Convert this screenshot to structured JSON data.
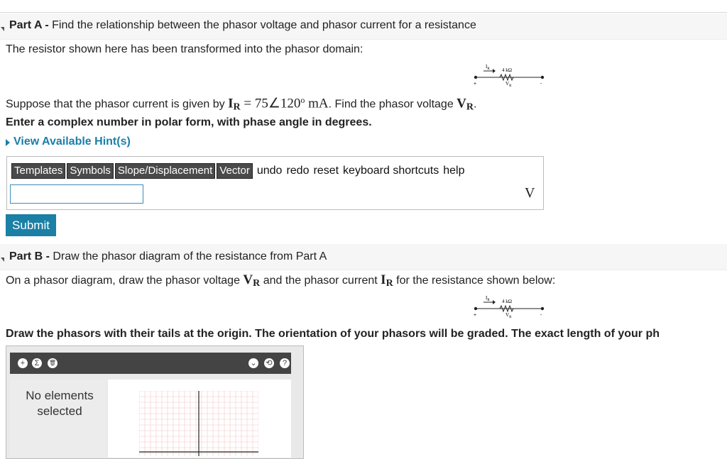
{
  "partA": {
    "label": "Part A - ",
    "title": "Find the relationship between the phasor voltage and phasor current for a resistance",
    "intro": "The resistor shown here has been transformed into the phasor domain:",
    "question_prefix": "Suppose that the phasor current is given by ",
    "I_sym": "I",
    "I_sub": "R",
    "eq": " = 75∠120",
    "deg": "o",
    "unit_ma": " mA",
    "question_mid": ". Find the phasor voltage ",
    "V_sym": "V",
    "V_sub": "R",
    "question_end": ".",
    "instruction": "Enter a complex number in polar form, with phase angle in degrees.",
    "hint": "View Available Hint(s)",
    "toolbar": {
      "templates": "Templates",
      "symbols": "Symbols",
      "slope": "Slope/Displacement",
      "vector": "Vector",
      "undo": "undo",
      "redo": "redo",
      "reset": "reset",
      "keyboard": "keyboard shortcuts",
      "help": "help"
    },
    "answer_value": "",
    "answer_unit": "V",
    "submit": "Submit"
  },
  "circuit": {
    "current_label": "I",
    "current_sub": "R",
    "resistance": "4 kΩ",
    "voltage_label": "V",
    "voltage_sub": "R",
    "plus": "+",
    "minus": "-"
  },
  "partB": {
    "label": "Part B - ",
    "title": "Draw the phasor diagram of the resistance from Part A",
    "intro_prefix": "On a phasor diagram, draw the phasor voltage ",
    "V_sym": "V",
    "V_sub": "R",
    "intro_mid": " and the phasor current ",
    "I_sym": "I",
    "I_sub": "R",
    "intro_end": " for the resistance shown below:",
    "instruction": "Draw the phasors with their tails at the origin. The orientation of your phasors will be graded. The exact length of your ph",
    "tool": {
      "add": "+",
      "sigma": "Σ",
      "trash": "🗑",
      "chevron": "⌄",
      "reset": "⟲",
      "help": "?",
      "no_elements": "No elements selected"
    }
  },
  "colors": {
    "accent": "#1b7fa6",
    "grid_minor": "#f3c6c6",
    "toolbar": "#444444"
  }
}
